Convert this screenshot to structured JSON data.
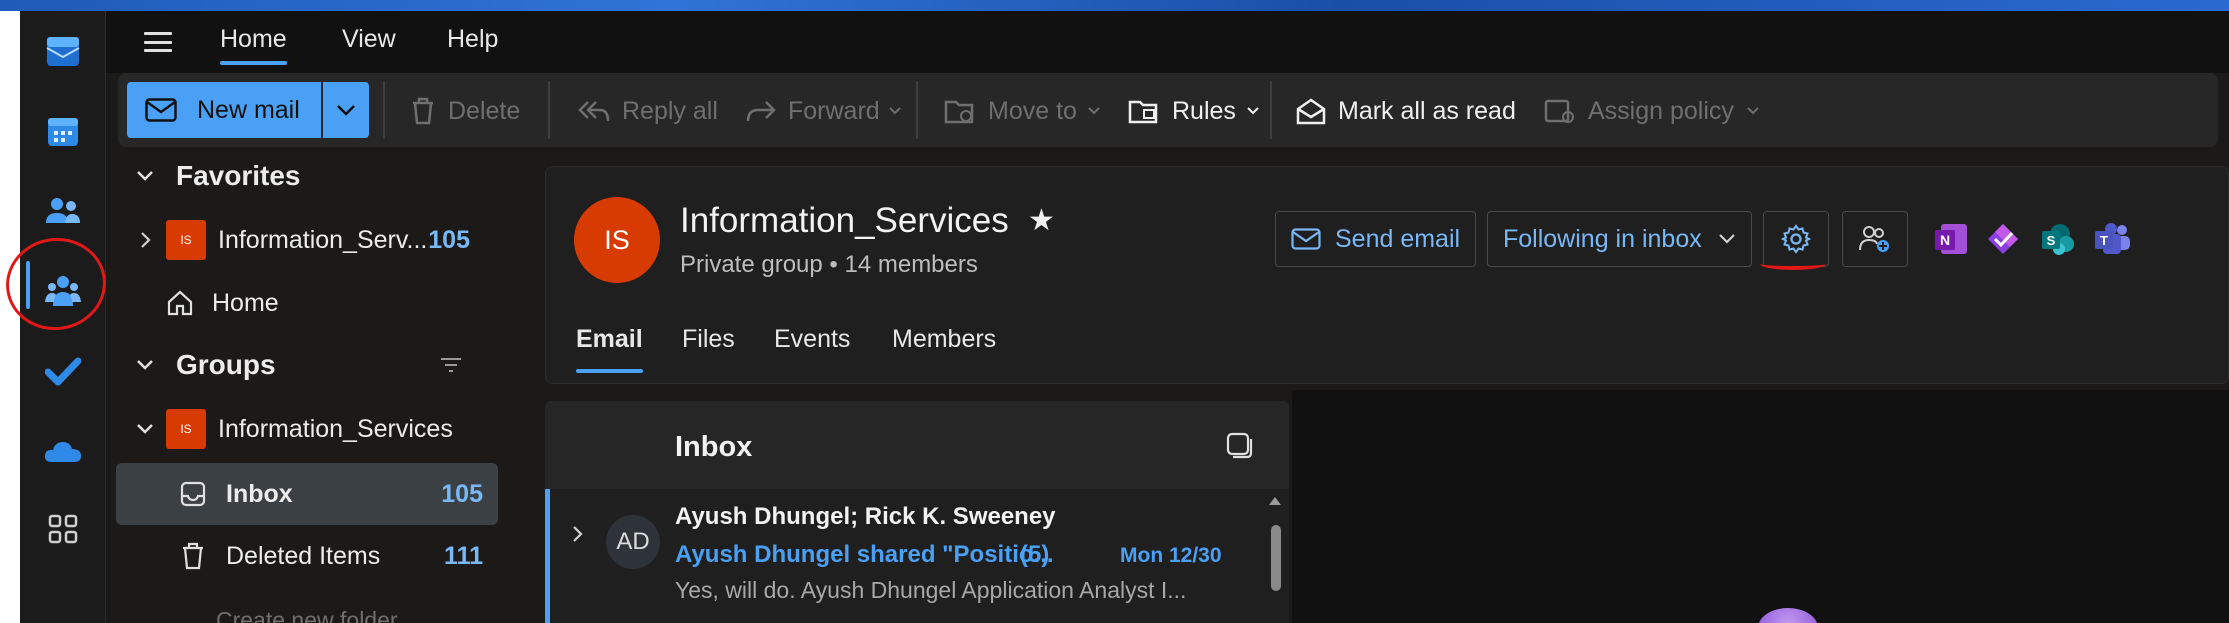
{
  "menubar": {
    "tabs": [
      {
        "label": "Home",
        "active": true
      },
      {
        "label": "View",
        "active": false
      },
      {
        "label": "Help",
        "active": false
      }
    ]
  },
  "ribbon": {
    "new_mail": "New mail",
    "delete": "Delete",
    "reply_all": "Reply all",
    "forward": "Forward",
    "move_to": "Move to",
    "rules": "Rules",
    "mark_all_read": "Mark all as read",
    "assign_policy": "Assign policy"
  },
  "folders": {
    "favorites_label": "Favorites",
    "favorite_group": {
      "badge": "IS",
      "name": "Information_Serv...",
      "count": "105"
    },
    "home_label": "Home",
    "groups_label": "Groups",
    "group": {
      "badge": "IS",
      "name": "Information_Services"
    },
    "inbox": {
      "label": "Inbox",
      "count": "105"
    },
    "deleted": {
      "label": "Deleted Items",
      "count": "111"
    },
    "create_folder": "Create new folder"
  },
  "group_header": {
    "avatar_initials": "IS",
    "title": "Information_Services",
    "subtitle": "Private group • 14 members",
    "send_email": "Send email",
    "following": "Following in inbox",
    "tabs": [
      "Email",
      "Files",
      "Events",
      "Members"
    ]
  },
  "mail_list": {
    "title": "Inbox",
    "items": [
      {
        "initials": "AD",
        "from": "Ayush Dhungel; Rick K. Sweeney",
        "subject": "Ayush Dhungel shared \"Positio...",
        "thread_count": "(5)",
        "date": "Mon 12/30",
        "preview": "Yes, will do. Ayush Dhungel Application Analyst I..."
      }
    ]
  },
  "colors": {
    "accent": "#4aa0f5",
    "group_badge": "#d83b01",
    "annotation": "#e11818"
  }
}
